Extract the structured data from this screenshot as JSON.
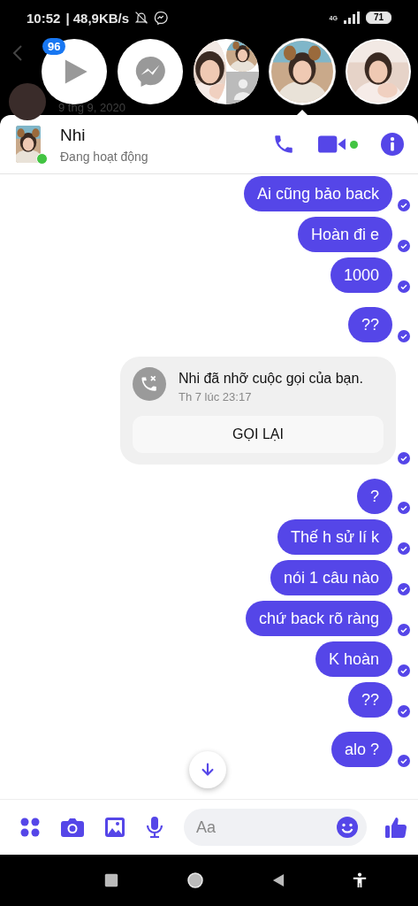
{
  "status_bar": {
    "time": "10:52",
    "speed": "| 48,9KB/s",
    "network": "4G",
    "battery": "71"
  },
  "background": {
    "date": "9 thg 9, 2020"
  },
  "chat_heads": [
    {
      "kind": "video",
      "badge": "96",
      "selected": false
    },
    {
      "kind": "messenger",
      "selected": false
    },
    {
      "kind": "group",
      "selected": false
    },
    {
      "kind": "picture",
      "selected": true
    },
    {
      "kind": "picture",
      "selected": false
    }
  ],
  "header": {
    "name": "Nhi",
    "status": "Đang hoạt động",
    "online": true
  },
  "messages": [
    {
      "kind": "text",
      "text": "Ai cũng bảo back",
      "delivered": true,
      "new_group": false
    },
    {
      "kind": "text",
      "text": "Hoàn đi e",
      "delivered": true,
      "new_group": false
    },
    {
      "kind": "text",
      "text": "1000",
      "delivered": true,
      "new_group": false
    },
    {
      "kind": "text",
      "text": "??",
      "delivered": true,
      "new_group": true
    },
    {
      "kind": "missed_call",
      "title": "Nhi đã nhỡ cuộc gọi của bạn.",
      "time": "Th 7 lúc 23:17",
      "button": "GỌI LẠI",
      "delivered": true,
      "new_group": true
    },
    {
      "kind": "text",
      "text": "?",
      "delivered": true,
      "new_group": true
    },
    {
      "kind": "text",
      "text": "Thế h sử lí k",
      "delivered": true,
      "new_group": false
    },
    {
      "kind": "text",
      "text": "nói 1 câu nào",
      "delivered": true,
      "new_group": false
    },
    {
      "kind": "text",
      "text": "chứ back rõ ràng",
      "delivered": true,
      "new_group": false
    },
    {
      "kind": "text",
      "text": "K hoàn",
      "delivered": true,
      "new_group": false
    },
    {
      "kind": "text",
      "text": "??",
      "delivered": true,
      "new_group": false
    },
    {
      "kind": "text",
      "text": "alo ?",
      "delivered": true,
      "new_group": true
    }
  ],
  "composer": {
    "placeholder": "Aa"
  }
}
